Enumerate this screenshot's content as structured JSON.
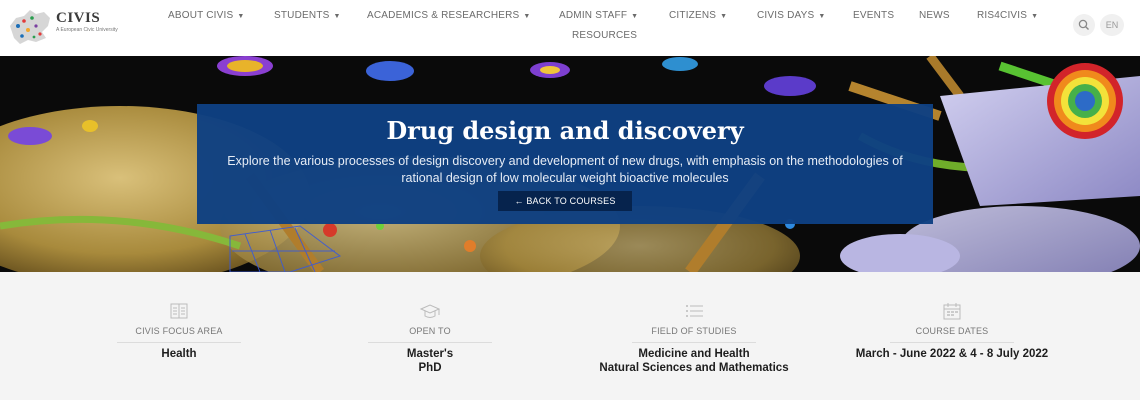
{
  "header": {
    "logo": {
      "name": "CIVIS",
      "tagline": "A European Civic University"
    },
    "nav": [
      {
        "label": "ABOUT CIVIS",
        "has_dropdown": true
      },
      {
        "label": "STUDENTS",
        "has_dropdown": true
      },
      {
        "label": "ACADEMICS & RESEARCHERS",
        "has_dropdown": true
      },
      {
        "label": "ADMIN STAFF",
        "has_dropdown": true
      },
      {
        "label": "CITIZENS",
        "has_dropdown": true
      },
      {
        "label": "CIVIS DAYS",
        "has_dropdown": true
      },
      {
        "label": "EVENTS",
        "has_dropdown": false
      },
      {
        "label": "NEWS",
        "has_dropdown": false
      },
      {
        "label": "RIS4CIVIS",
        "has_dropdown": true
      },
      {
        "label": "RESOURCES",
        "has_dropdown": false
      }
    ],
    "search_icon": "search-icon",
    "language": "EN"
  },
  "hero": {
    "title": "Drug design and discovery",
    "description": "Explore the various processes of design discovery and development of new drugs, with emphasis on the methodologies of rational design of low molecular weight bioactive molecules",
    "back_button": "← BACK TO COURSES"
  },
  "info": [
    {
      "icon": "focus-area-icon",
      "label": "CIVIS FOCUS AREA",
      "values": [
        "Health"
      ]
    },
    {
      "icon": "graduation-cap-icon",
      "label": "OPEN TO",
      "values": [
        "Master's",
        "PhD"
      ]
    },
    {
      "icon": "list-icon",
      "label": "FIELD OF STUDIES",
      "values": [
        "Medicine and Health",
        "Natural Sciences and Mathematics"
      ]
    },
    {
      "icon": "calendar-icon",
      "label": "COURSE DATES",
      "values": [
        "March - June 2022 & 4 - 8 July 2022"
      ]
    }
  ],
  "colors": {
    "hero_box": "#0e4082",
    "back_button": "#06234d",
    "info_background": "#f4f4f4"
  }
}
